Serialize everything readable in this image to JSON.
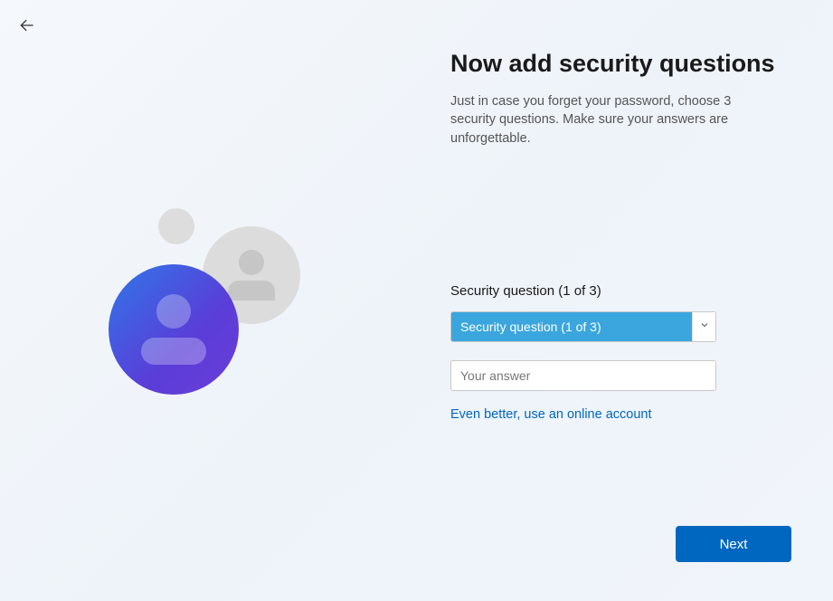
{
  "header": {
    "title": "Now add security questions",
    "subtitle": "Just in case you forget your password, choose 3 security questions. Make sure your answers are unforgettable."
  },
  "form": {
    "question_label": "Security question (1 of 3)",
    "question_select_text": "Security question (1 of 3)",
    "answer_placeholder": "Your answer",
    "online_account_link": "Even better, use an online account"
  },
  "buttons": {
    "next": "Next"
  }
}
